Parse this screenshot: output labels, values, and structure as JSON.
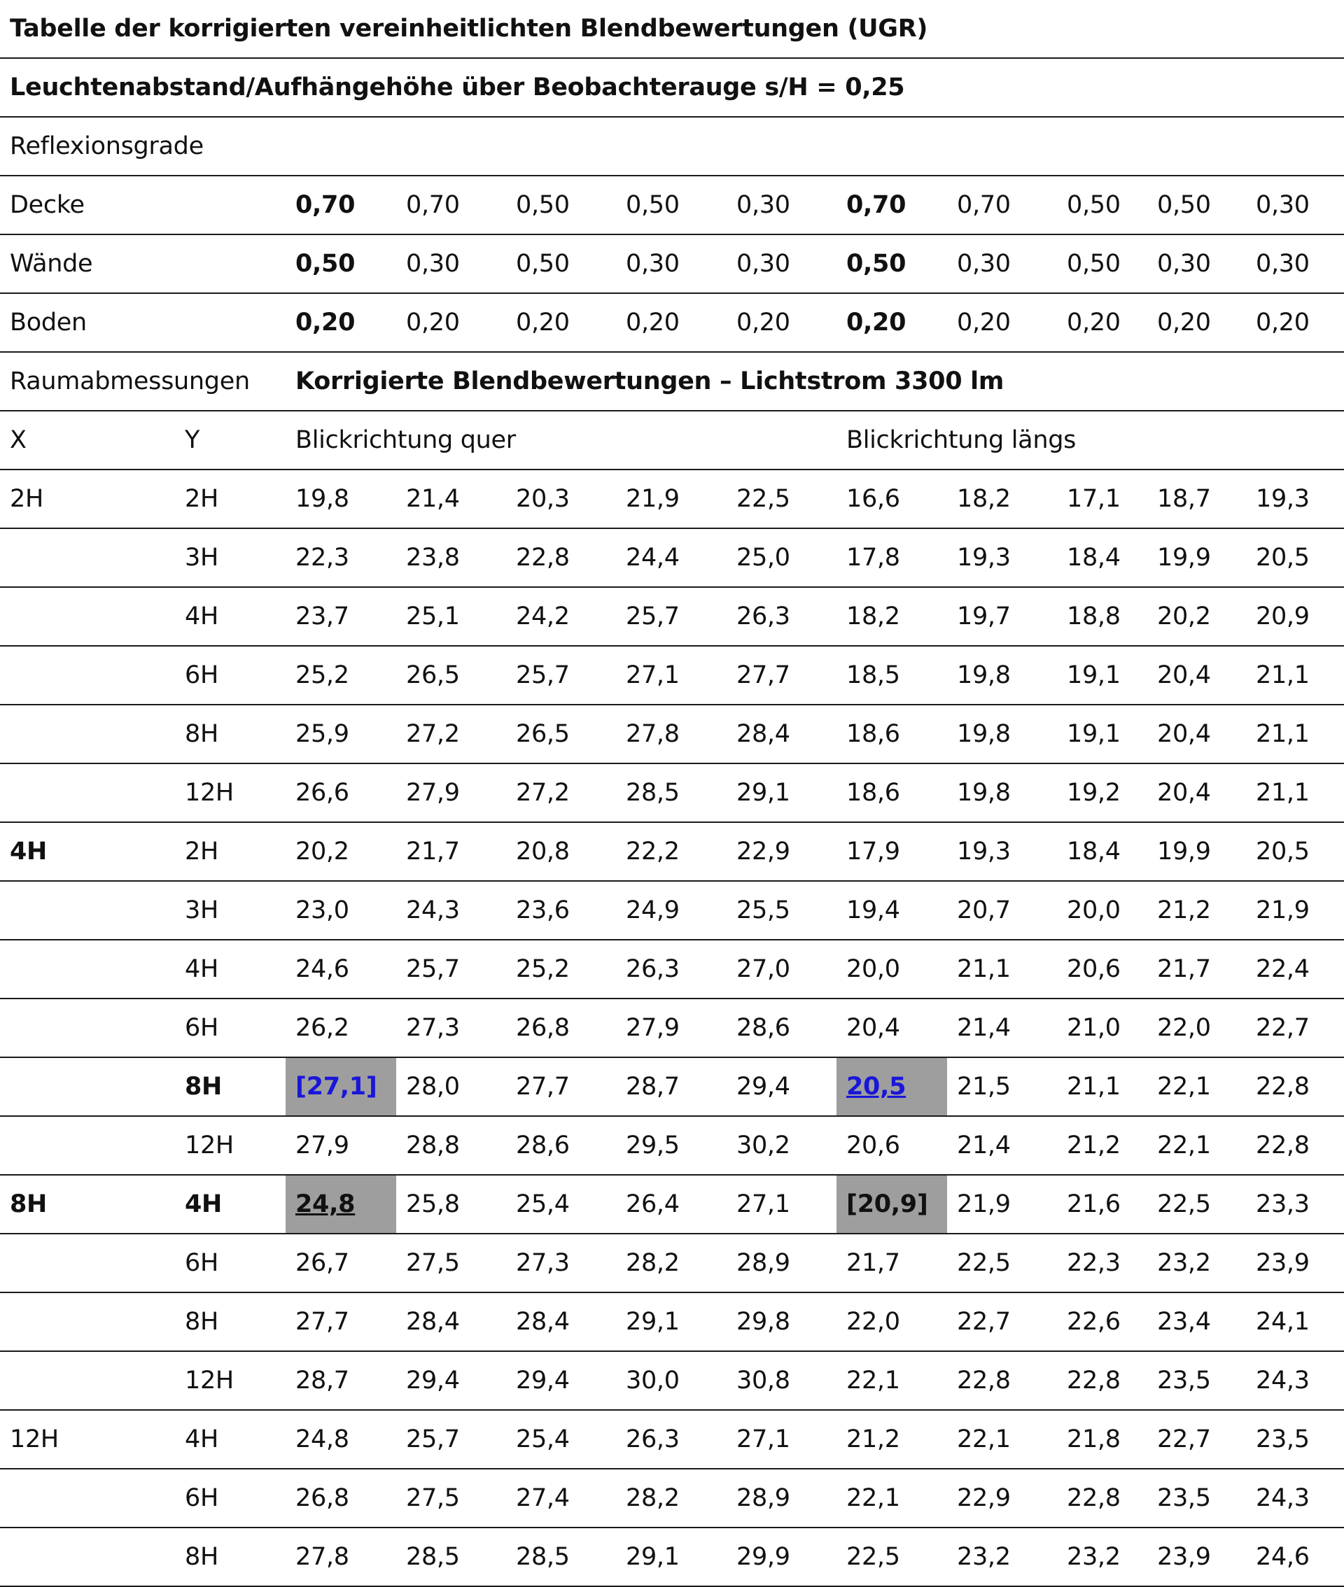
{
  "title": "Tabelle der korrigierten vereinheitlichten Blendbewertungen (UGR)",
  "spacing_row": "Leuchtenabstand/Aufhängehöhe über Beobachterauge s/H = 0,25",
  "reflection": {
    "label": "Reflexionsgrade",
    "rows": [
      {
        "label": "Decke",
        "values": [
          "0,70",
          "0,70",
          "0,50",
          "0,50",
          "0,30",
          "0,70",
          "0,70",
          "0,50",
          "0,50",
          "0,30"
        ]
      },
      {
        "label": "Wände",
        "values": [
          "0,50",
          "0,30",
          "0,50",
          "0,30",
          "0,30",
          "0,50",
          "0,30",
          "0,50",
          "0,30",
          "0,30"
        ]
      },
      {
        "label": "Boden",
        "values": [
          "0,20",
          "0,20",
          "0,20",
          "0,20",
          "0,20",
          "0,20",
          "0,20",
          "0,20",
          "0,20",
          "0,20"
        ]
      }
    ]
  },
  "room": {
    "label": "Raumabmessungen",
    "rating_label": "Korrigierte Blendbewertungen – Lichtstrom 3300 lm"
  },
  "headers": {
    "x": "X",
    "y": "Y",
    "quer": "Blickrichtung quer",
    "laengs": "Blickrichtung längs"
  },
  "rows": [
    {
      "x": "2H",
      "y": "2H",
      "values": [
        "19,8",
        "21,4",
        "20,3",
        "21,9",
        "22,5",
        "16,6",
        "18,2",
        "17,1",
        "18,7",
        "19,3"
      ]
    },
    {
      "x": "",
      "y": "3H",
      "values": [
        "22,3",
        "23,8",
        "22,8",
        "24,4",
        "25,0",
        "17,8",
        "19,3",
        "18,4",
        "19,9",
        "20,5"
      ]
    },
    {
      "x": "",
      "y": "4H",
      "values": [
        "23,7",
        "25,1",
        "24,2",
        "25,7",
        "26,3",
        "18,2",
        "19,7",
        "18,8",
        "20,2",
        "20,9"
      ]
    },
    {
      "x": "",
      "y": "6H",
      "values": [
        "25,2",
        "26,5",
        "25,7",
        "27,1",
        "27,7",
        "18,5",
        "19,8",
        "19,1",
        "20,4",
        "21,1"
      ]
    },
    {
      "x": "",
      "y": "8H",
      "values": [
        "25,9",
        "27,2",
        "26,5",
        "27,8",
        "28,4",
        "18,6",
        "19,8",
        "19,1",
        "20,4",
        "21,1"
      ]
    },
    {
      "x": "",
      "y": "12H",
      "values": [
        "26,6",
        "27,9",
        "27,2",
        "28,5",
        "29,1",
        "18,6",
        "19,8",
        "19,2",
        "20,4",
        "21,1"
      ]
    },
    {
      "x": "4H",
      "y": "2H",
      "values": [
        "20,2",
        "21,7",
        "20,8",
        "22,2",
        "22,9",
        "17,9",
        "19,3",
        "18,4",
        "19,9",
        "20,5"
      ]
    },
    {
      "x": "",
      "y": "3H",
      "values": [
        "23,0",
        "24,3",
        "23,6",
        "24,9",
        "25,5",
        "19,4",
        "20,7",
        "20,0",
        "21,2",
        "21,9"
      ]
    },
    {
      "x": "",
      "y": "4H",
      "values": [
        "24,6",
        "25,7",
        "25,2",
        "26,3",
        "27,0",
        "20,0",
        "21,1",
        "20,6",
        "21,7",
        "22,4"
      ]
    },
    {
      "x": "",
      "y": "6H",
      "values": [
        "26,2",
        "27,3",
        "26,8",
        "27,9",
        "28,6",
        "20,4",
        "21,4",
        "21,0",
        "22,0",
        "22,7"
      ]
    },
    {
      "x": "",
      "y": "8H",
      "values": [
        "[27,1]",
        "28,0",
        "27,7",
        "28,7",
        "29,4",
        "20,5",
        "21,5",
        "21,1",
        "22,1",
        "22,8"
      ]
    },
    {
      "x": "",
      "y": "12H",
      "values": [
        "27,9",
        "28,8",
        "28,6",
        "29,5",
        "30,2",
        "20,6",
        "21,4",
        "21,2",
        "22,1",
        "22,8"
      ]
    },
    {
      "x": "8H",
      "y": "4H",
      "values": [
        "24,8",
        "25,8",
        "25,4",
        "26,4",
        "27,1",
        "[20,9]",
        "21,9",
        "21,6",
        "22,5",
        "23,3"
      ]
    },
    {
      "x": "",
      "y": "6H",
      "values": [
        "26,7",
        "27,5",
        "27,3",
        "28,2",
        "28,9",
        "21,7",
        "22,5",
        "22,3",
        "23,2",
        "23,9"
      ]
    },
    {
      "x": "",
      "y": "8H",
      "values": [
        "27,7",
        "28,4",
        "28,4",
        "29,1",
        "29,8",
        "22,0",
        "22,7",
        "22,6",
        "23,4",
        "24,1"
      ]
    },
    {
      "x": "",
      "y": "12H",
      "values": [
        "28,7",
        "29,4",
        "29,4",
        "30,0",
        "30,8",
        "22,1",
        "22,8",
        "22,8",
        "23,5",
        "24,3"
      ]
    },
    {
      "x": "12H",
      "y": "4H",
      "values": [
        "24,8",
        "25,7",
        "25,4",
        "26,3",
        "27,1",
        "21,2",
        "22,1",
        "21,8",
        "22,7",
        "23,5"
      ]
    },
    {
      "x": "",
      "y": "6H",
      "values": [
        "26,8",
        "27,5",
        "27,4",
        "28,2",
        "28,9",
        "22,1",
        "22,9",
        "22,8",
        "23,5",
        "24,3"
      ]
    },
    {
      "x": "",
      "y": "8H",
      "values": [
        "27,8",
        "28,5",
        "28,5",
        "29,1",
        "29,9",
        "22,5",
        "23,2",
        "23,2",
        "23,9",
        "24,6"
      ]
    }
  ],
  "colors": {
    "highlight": "#9e9e9e",
    "link_blue": "#1a16d8",
    "rule": "#1a1a1a"
  }
}
